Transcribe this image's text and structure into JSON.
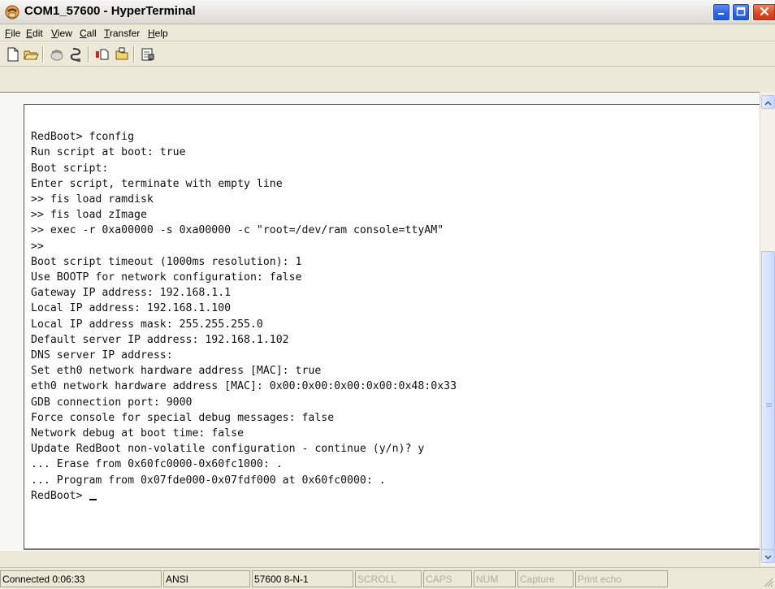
{
  "window": {
    "title": "COM1_57600 - HyperTerminal",
    "app_icon": "hyperterminal-phone-icon",
    "controls": [
      "minimize-icon",
      "maximize-icon",
      "close-icon"
    ]
  },
  "menu": {
    "items": [
      {
        "label": "File",
        "mnemonic": "F"
      },
      {
        "label": "Edit",
        "mnemonic": "E"
      },
      {
        "label": "View",
        "mnemonic": "V"
      },
      {
        "label": "Call",
        "mnemonic": "C"
      },
      {
        "label": "Transfer",
        "mnemonic": "T"
      },
      {
        "label": "Help",
        "mnemonic": "H"
      }
    ]
  },
  "toolbar": {
    "icons": [
      "new-document-icon",
      "open-folder-icon",
      "call-phone-icon",
      "disconnect-icon",
      "send-file-icon",
      "receive-file-icon",
      "properties-icon"
    ]
  },
  "terminal": {
    "lines": [
      "RedBoot> fconfig",
      "Run script at boot: true",
      "Boot script:",
      "Enter script, terminate with empty line",
      ">> fis load ramdisk",
      ">> fis load zImage",
      ">> exec -r 0xa00000 -s 0xa00000 -c \"root=/dev/ram console=ttyAM\"",
      ">>",
      "Boot script timeout (1000ms resolution): 1",
      "Use BOOTP for network configuration: false",
      "Gateway IP address: 192.168.1.1",
      "Local IP address: 192.168.1.100",
      "Local IP address mask: 255.255.255.0",
      "Default server IP address: 192.168.1.102",
      "DNS server IP address:",
      "Set eth0 network hardware address [MAC]: true",
      "eth0 network hardware address [MAC]: 0x00:0x00:0x00:0x00:0x48:0x33",
      "GDB connection port: 9000",
      "Force console for special debug messages: false",
      "Network debug at boot time: false",
      "Update RedBoot non-volatile configuration - continue (y/n)? y",
      "... Erase from 0x60fc0000-0x60fc1000: .",
      "... Program from 0x07fde000-0x07fdf000 at 0x60fc0000: .",
      "RedBoot> "
    ]
  },
  "status": {
    "connected": "Connected 0:06:33",
    "emulation": "ANSI",
    "port_settings": "57600 8-N-1",
    "scroll": "SCROLL",
    "caps": "CAPS",
    "num": "NUM",
    "capture": "Capture",
    "print_echo": "Print echo"
  }
}
